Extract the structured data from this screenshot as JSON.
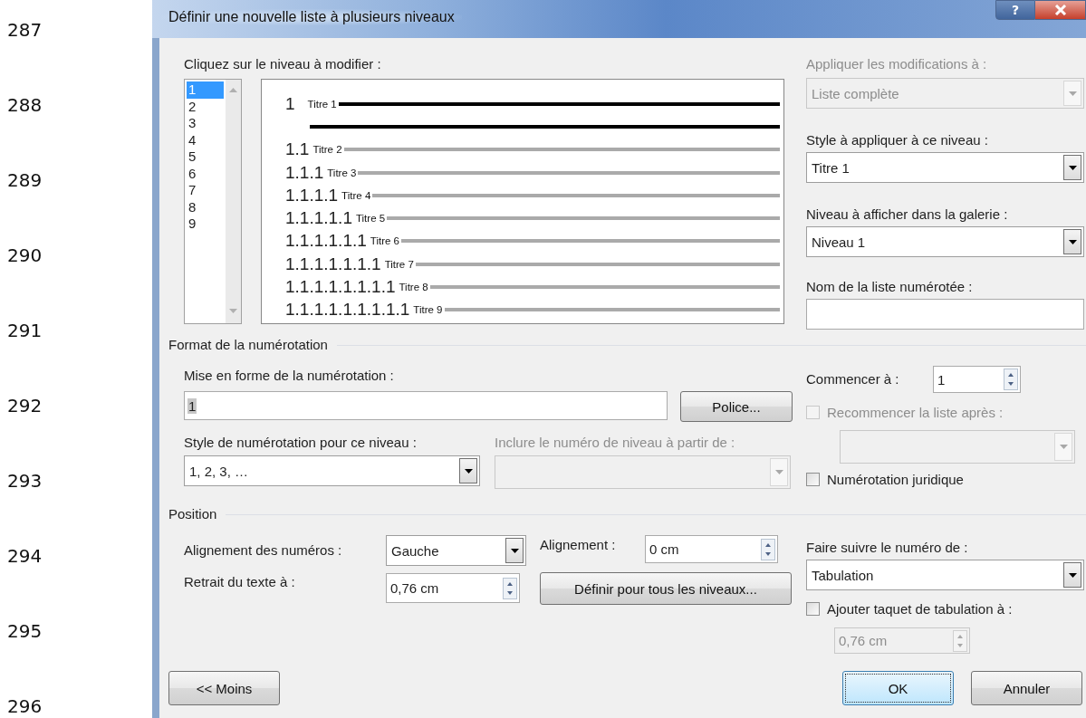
{
  "line_numbers": [
    "287",
    "288",
    "289",
    "290",
    "291",
    "292",
    "293",
    "294",
    "295",
    "296"
  ],
  "window": {
    "title": "Définir une nouvelle liste à plusieurs niveaux",
    "help": "?"
  },
  "levels": {
    "label": "Cliquez sur le niveau à modifier :",
    "items": [
      {
        "label": "1",
        "selected": true
      },
      {
        "label": "2",
        "selected": false
      },
      {
        "label": "3",
        "selected": false
      },
      {
        "label": "4",
        "selected": false
      },
      {
        "label": "5",
        "selected": false
      },
      {
        "label": "6",
        "selected": false
      },
      {
        "label": "7",
        "selected": false
      },
      {
        "label": "8",
        "selected": false
      },
      {
        "label": "9",
        "selected": false
      }
    ]
  },
  "preview": {
    "rows": [
      {
        "number": "1",
        "style": "Titre 1",
        "selected": true
      },
      {
        "number": "1.1",
        "style": "Titre 2",
        "selected": false
      },
      {
        "number": "1.1.1",
        "style": "Titre 3",
        "selected": false
      },
      {
        "number": "1.1.1.1",
        "style": "Titre 4",
        "selected": false
      },
      {
        "number": "1.1.1.1.1",
        "style": "Titre 5",
        "selected": false
      },
      {
        "number": "1.1.1.1.1.1",
        "style": "Titre 6",
        "selected": false
      },
      {
        "number": "1.1.1.1.1.1.1",
        "style": "Titre 7",
        "selected": false
      },
      {
        "number": "1.1.1.1.1.1.1.1",
        "style": "Titre 8",
        "selected": false
      },
      {
        "number": "1.1.1.1.1.1.1.1.1",
        "style": "Titre 9",
        "selected": false
      }
    ]
  },
  "apply_to": {
    "label": "Appliquer les modifications à :",
    "value": "Liste complète",
    "disabled": true
  },
  "level_style": {
    "label": "Style à appliquer à ce niveau :",
    "value": "Titre 1",
    "disabled": false
  },
  "gallery_level": {
    "label": "Niveau à afficher dans la galerie :",
    "value": "Niveau 1",
    "disabled": false
  },
  "list_name": {
    "label": "Nom de la liste numérotée :"
  },
  "number_format": {
    "title": "Format de la numérotation",
    "format_label": "Mise en forme de la numérotation :",
    "format_value": "1",
    "font_button": "Police...",
    "style_label": "Style de numérotation pour ce niveau :",
    "style": {
      "value": "1, 2, 3, …",
      "disabled": false
    },
    "include_label": "Inclure le numéro de niveau à partir de :",
    "include": {
      "disabled": true
    },
    "start_label": "Commencer à :",
    "start_value": "1",
    "restart": {
      "label": "Recommencer la liste après :",
      "checked": false,
      "disabled": true
    },
    "restart_list": {
      "disabled": true
    },
    "legal": {
      "label": "Numérotation juridique",
      "checked": false,
      "disabled": false
    }
  },
  "position": {
    "title": "Position",
    "number_align_label": "Alignement des numéros :",
    "number_align": {
      "value": "Gauche",
      "disabled": false
    },
    "align_label": "Alignement :",
    "align_value": "0 cm",
    "indent_label": "Retrait du texte à :",
    "indent_value": "0,76 cm",
    "set_all_button": "Définir pour tous les niveaux...",
    "follow_label": "Faire suivre le numéro de :",
    "follow": {
      "value": "Tabulation",
      "disabled": false
    },
    "tab_stop": {
      "label": "Ajouter taquet de tabulation à :",
      "checked": false,
      "disabled": false
    },
    "tab_stop_value": {
      "value": "0,76 cm",
      "disabled": true
    }
  },
  "buttons": [
    {
      "label": "<< Moins",
      "kind": "left"
    },
    {
      "label": "OK",
      "kind": "default"
    },
    {
      "label": "Annuler",
      "kind": "right"
    }
  ]
}
